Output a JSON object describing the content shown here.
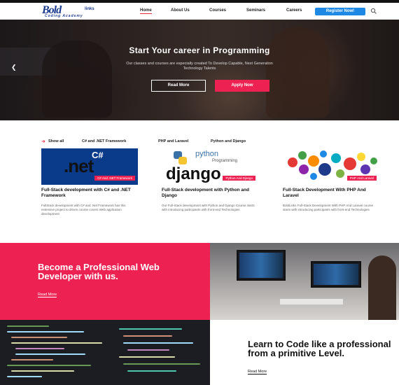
{
  "header": {
    "logo_text": "Bold",
    "logo_suffix": "links",
    "logo_sub": "Coding Academy",
    "nav": [
      "Home",
      "About Us",
      "Courses",
      "Seminars",
      "Careers"
    ],
    "register_label": "Register Now!"
  },
  "hero": {
    "title": "Start Your career in Programming",
    "subtitle": "Our classes and courses are especially created To Develop Capable, Next Generation Technology Talents",
    "read_more": "Read More",
    "apply_now": "Apply Now"
  },
  "filters": [
    "Show all",
    "C# and .NET Framework",
    "PHP and Laravel",
    "Python and Django"
  ],
  "courses": [
    {
      "badge": "C# And .NET Framework",
      "title": "Full-Stack development with C# and .NET Framework",
      "desc": "FullStack development with C# and .Net Framework has this extensive project to driven course covers Web application development"
    },
    {
      "badge": "Python And Django",
      "title": "Full-Stack development with Python and Django",
      "desc": "Our Full-Stack development with Python and Django Course starts with introducing participants with front-end Technologies"
    },
    {
      "badge": "PHP And Laravel",
      "title": "Full-Stack Development With PHP And Laravel",
      "desc": "BoldLinks Full-Stack Development With PHP And Laravel course starts with introducing participants with front-end Technologies"
    }
  ],
  "promo": {
    "become_title": "Become a Professional Web Developer with us.",
    "become_link": "Read More",
    "learn_title": "Learn to Code like a professional from a primitive Level.",
    "learn_link": "Read More"
  },
  "thumb_text": {
    "csharp": "C#",
    "net": ".net",
    "python": "python",
    "programming": "Programming",
    "django": "django"
  },
  "colors": {
    "accent": "#ee2252",
    "nav_blue": "#1e88e5",
    "logo_blue": "#1a3a8f"
  },
  "icons": [
    "search-icon",
    "chevron-left-icon",
    "arrow-right-icon"
  ]
}
